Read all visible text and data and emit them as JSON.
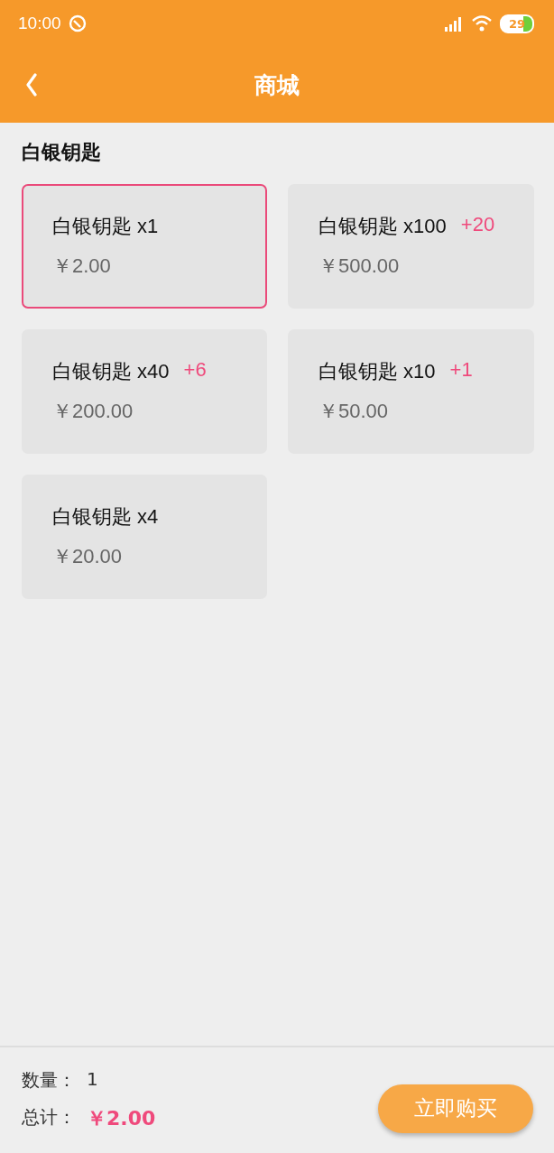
{
  "status_bar": {
    "time": "10:00",
    "battery": "29"
  },
  "header": {
    "title": "商城"
  },
  "section": {
    "title": "白银钥匙"
  },
  "products": [
    {
      "name": "白银钥匙 x1",
      "price": "￥2.00",
      "selected": true
    },
    {
      "name": "白银钥匙 x100",
      "bonus": "+20",
      "price": "￥500.00",
      "selected": false
    },
    {
      "name": "白银钥匙 x40",
      "bonus": "+6",
      "price": "￥200.00",
      "selected": false
    },
    {
      "name": "白银钥匙 x10",
      "bonus": "+1",
      "price": "￥50.00",
      "selected": false
    },
    {
      "name": "白银钥匙 x4",
      "price": "￥20.00",
      "selected": false
    }
  ],
  "footer": {
    "quantity_label": "数量：",
    "quantity": "1",
    "total_label": "总计：",
    "total": "￥2.00",
    "buy_button": "立即购买"
  }
}
